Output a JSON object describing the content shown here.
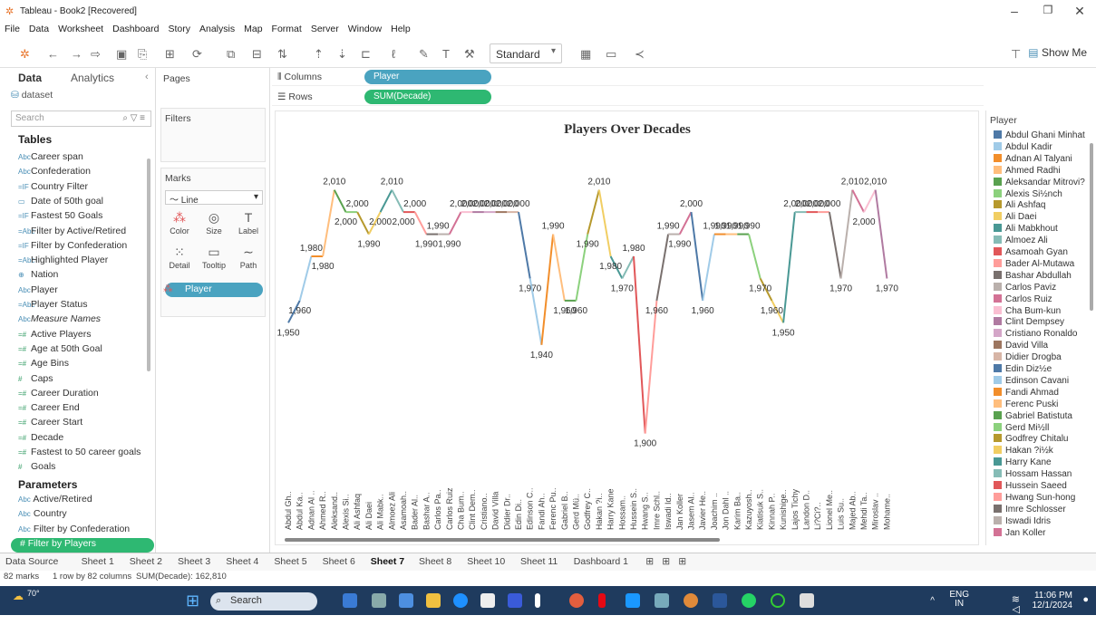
{
  "window": {
    "title": "Tableau - Book2 [Recovered]"
  },
  "menu": [
    "File",
    "Data",
    "Worksheet",
    "Dashboard",
    "Story",
    "Analysis",
    "Map",
    "Format",
    "Server",
    "Window",
    "Help"
  ],
  "toolbar": {
    "fit": "Standard",
    "show_me": "Show Me"
  },
  "datapane": {
    "tab_data": "Data",
    "tab_analytics": "Analytics",
    "datasource": "dataset",
    "search_placeholder": "Search",
    "tables_header": "Tables",
    "fields": [
      {
        "icon": "Abc",
        "label": "Career span"
      },
      {
        "icon": "Abc",
        "label": "Confederation"
      },
      {
        "icon": "=IF",
        "label": "Country Filter"
      },
      {
        "icon": "▭",
        "label": "Date of 50th goal"
      },
      {
        "icon": "=IF",
        "label": "Fastest 50 Goals"
      },
      {
        "icon": "=Abc",
        "label": "Filter by Active/Retired"
      },
      {
        "icon": "=IF",
        "label": "Filter by Confederation"
      },
      {
        "icon": "=Abc",
        "label": "Highlighted Player"
      },
      {
        "icon": "⊕",
        "label": "Nation"
      },
      {
        "icon": "Abc",
        "label": "Player"
      },
      {
        "icon": "=Abc",
        "label": "Player Status"
      },
      {
        "icon": "Abc",
        "label": "Measure Names"
      },
      {
        "icon": "=#",
        "label": "Active Players"
      },
      {
        "icon": "=#",
        "label": "Age at 50th Goal"
      },
      {
        "icon": "=#",
        "label": "Age Bins"
      },
      {
        "icon": "#",
        "label": "Caps"
      },
      {
        "icon": "=#",
        "label": "Career Duration"
      },
      {
        "icon": "=#",
        "label": "Career End"
      },
      {
        "icon": "=#",
        "label": "Career Start"
      },
      {
        "icon": "=#",
        "label": "Decade"
      },
      {
        "icon": "=#",
        "label": "Fastest to 50 career goals"
      },
      {
        "icon": "#",
        "label": "Goals"
      }
    ],
    "parameters_header": "Parameters",
    "parameters": [
      {
        "icon": "Abc",
        "label": "Active/Retired"
      },
      {
        "icon": "Abc",
        "label": "Country"
      },
      {
        "icon": "Abc",
        "label": "Filter by Confederation"
      },
      {
        "icon": "#",
        "label": "Filter by Players"
      }
    ]
  },
  "shelves": {
    "pages": "Pages",
    "filters": "Filters",
    "marks": "Marks",
    "mark_type": "Line",
    "marks_buttons": [
      "Color",
      "Size",
      "Label",
      "Detail",
      "Tooltip",
      "Path"
    ],
    "marks_pill": "Player",
    "columns_label": "Columns",
    "columns_pill": "Player",
    "rows_label": "Rows",
    "rows_pill": "SUM(Decade)"
  },
  "colors": {
    "columns_pill": "#4aa3c0",
    "rows_pill": "#2eb872",
    "marks_pill": "#4aa3c0",
    "accent": "#2eb872"
  },
  "chart_data": {
    "type": "line",
    "title": "Players Over Decades",
    "categories": [
      "Abdul Gh..",
      "Abdul Ka..",
      "Adnan Al ..",
      "Ahmed R..",
      "Aleksand..",
      "Alexis Si..",
      "Ali Ashfaq",
      "Ali Daei",
      "Ali Mabk..",
      "Almoez Ali",
      "Asamoah..",
      "Bader Al..",
      "Bashar A..",
      "Carlos Pa..",
      "Carlos Ruiz",
      "Cha Bum..",
      "Clint Dem..",
      "Cristiano..",
      "David Villa",
      "Didier Dr..",
      "Edin Di..",
      "Edinson C..",
      "Fandi Ah..",
      "Ferenc Pu..",
      "Gabriel B..",
      "Gerd Mü..",
      "Godfrey C..",
      "Hakan ?i..",
      "Harry Kane",
      "Hossam..",
      "Hussein S..",
      "Hwang S..",
      "Imre Schl..",
      "Iswadi Id..",
      "Jan Koller",
      "Jasem Al..",
      "Javier He..",
      "Joachim ..",
      "Jon Dahl ..",
      "Karim Ba..",
      "Kazuyosh..",
      "Kiatisuk S..",
      "Kinnah P..",
      "Kunishige..",
      "Lajos Tichy",
      "Landon D..",
      "Li?Ci?..",
      "Lionel Me..",
      "Luis Su..",
      "Majed Ab..",
      "Mehdi Ta..",
      "Miroslav ..",
      "Mohame.."
    ],
    "values": [
      1950,
      1960,
      1980,
      1980,
      2010,
      2000,
      2000,
      1990,
      2000,
      2010,
      2000,
      2000,
      1990,
      1990,
      1990,
      2000,
      2000,
      2000,
      2000,
      2000,
      2000,
      1970,
      1940,
      1990,
      1960,
      1960,
      1990,
      2010,
      1980,
      1970,
      1980,
      1900,
      1960,
      1990,
      1990,
      2000,
      1960,
      1990,
      1990,
      1990,
      1990,
      1970,
      1960,
      1950,
      2000,
      2000,
      2000,
      2000,
      1970,
      2010,
      2000,
      2010,
      1970
    ],
    "ylabel": "",
    "xlabel": "",
    "ylim": [
      1890,
      2025
    ]
  },
  "legend": {
    "title": "Player",
    "items": [
      {
        "label": "Abdul Ghani Minhat",
        "color": "#4e79a7"
      },
      {
        "label": "Abdul Kadir",
        "color": "#a0cbe8"
      },
      {
        "label": "Adnan Al Talyani",
        "color": "#f28e2b"
      },
      {
        "label": "Ahmed Radhi",
        "color": "#ffbe7d"
      },
      {
        "label": "Aleksandar Mitrovi?",
        "color": "#59a14f"
      },
      {
        "label": "Alexis Si½nch",
        "color": "#8cd17d"
      },
      {
        "label": "Ali Ashfaq",
        "color": "#b6992d"
      },
      {
        "label": "Ali Daei",
        "color": "#f1ce63"
      },
      {
        "label": "Ali Mabkhout",
        "color": "#499894"
      },
      {
        "label": "Almoez Ali",
        "color": "#86bcb6"
      },
      {
        "label": "Asamoah Gyan",
        "color": "#e15759"
      },
      {
        "label": "Bader Al-Mutawa",
        "color": "#ff9d9a"
      },
      {
        "label": "Bashar Abdullah",
        "color": "#79706e"
      },
      {
        "label": "Carlos Paviz",
        "color": "#bab0ac"
      },
      {
        "label": "Carlos Ruiz",
        "color": "#d37295"
      },
      {
        "label": "Cha Bum-kun",
        "color": "#fabfd2"
      },
      {
        "label": "Clint Dempsey",
        "color": "#b07aa1"
      },
      {
        "label": "Cristiano Ronaldo",
        "color": "#d4a6c8"
      },
      {
        "label": "David Villa",
        "color": "#9d7660"
      },
      {
        "label": "Didier Drogba",
        "color": "#d7b5a6"
      },
      {
        "label": "Edin Diz½e",
        "color": "#4e79a7"
      },
      {
        "label": "Edinson Cavani",
        "color": "#a0cbe8"
      },
      {
        "label": "Fandi Ahmad",
        "color": "#f28e2b"
      },
      {
        "label": "Ferenc Puski",
        "color": "#ffbe7d"
      },
      {
        "label": "Gabriel Batistuta",
        "color": "#59a14f"
      },
      {
        "label": "Gerd Mi½ll",
        "color": "#8cd17d"
      },
      {
        "label": "Godfrey Chitalu",
        "color": "#b6992d"
      },
      {
        "label": "Hakan ?i½k",
        "color": "#f1ce63"
      },
      {
        "label": "Harry Kane",
        "color": "#499894"
      },
      {
        "label": "Hossam Hassan",
        "color": "#86bcb6"
      },
      {
        "label": "Hussein Saeed",
        "color": "#e15759"
      },
      {
        "label": "Hwang Sun-hong",
        "color": "#ff9d9a"
      },
      {
        "label": "Imre Schlosser",
        "color": "#79706e"
      },
      {
        "label": "Iswadi Idris",
        "color": "#bab0ac"
      },
      {
        "label": "Jan Koller",
        "color": "#d37295"
      }
    ]
  },
  "sheets": [
    "Data Source",
    "Sheet 1",
    "Sheet 2",
    "Sheet 3",
    "Sheet 4",
    "Sheet 5",
    "Sheet 6",
    "Sheet 7",
    "Sheet 8",
    "Sheet 10",
    "Sheet 11",
    "Dashboard 1"
  ],
  "active_sheet": "Sheet 7",
  "status": {
    "marks": "82 marks",
    "rows": "1 row by 82 columns",
    "sum": "SUM(Decade): 162,810"
  },
  "taskbar": {
    "weather": "70°",
    "search": "Search",
    "lang1": "ENG",
    "lang2": "IN",
    "time": "11:06 PM",
    "date": "12/1/2024"
  }
}
